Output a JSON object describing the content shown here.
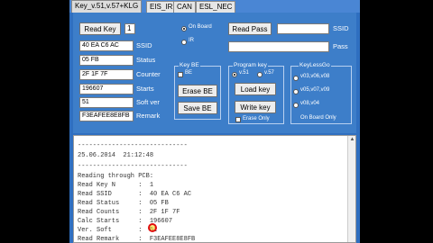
{
  "tabs": [
    {
      "label": "Key_v.51,v.57+KLG"
    },
    {
      "label": "EIS_IR"
    },
    {
      "label": "CAN"
    },
    {
      "label": "ESL_NEC"
    }
  ],
  "read_key": {
    "button": "Read Key",
    "number": "1"
  },
  "onboard": {
    "on_board": "On Board",
    "ir": "IR"
  },
  "read_pass": {
    "button": "Read Pass",
    "ssid_label": "SSID",
    "pass_label": "Pass",
    "ssid_value": "",
    "pass_value": ""
  },
  "fields": [
    {
      "value": "40 EA C6 AC",
      "label": "SSID"
    },
    {
      "value": "05 FB",
      "label": "Status"
    },
    {
      "value": "2F 1F 7F",
      "label": "Counter"
    },
    {
      "value": "196607",
      "label": "Starts"
    },
    {
      "value": "51",
      "label": "Soft ver"
    },
    {
      "value": "F3EAFEE8E8FB",
      "label": "Remark"
    }
  ],
  "key_be": {
    "title": "Key BE",
    "option": "BE",
    "erase": "Erase BE",
    "save": "Save BE"
  },
  "program_key": {
    "title": "Program key",
    "v51": "v.51",
    "v57": "v.57",
    "load": "Load key",
    "write": "Write key",
    "erase_only": "Erase Only"
  },
  "keyless": {
    "title": "KeyLessGo",
    "opt1": "v03,v06,v08",
    "opt2": "v05,v07,v09",
    "opt3": "v08,v04",
    "onboard_only": "On Board Only"
  },
  "log": [
    "-----------------------------",
    "25.06.2014  21:12:48",
    "-----------------------------",
    "Reading through PCB:",
    "Read Key N      :  1",
    "Read SSID       :  40 EA C6 AC",
    "Read Status     :  05 FB",
    "Read Counts     :  2F 1F 7F",
    "Calc Starts     :  196607",
    "Ver. Soft       :  51",
    "Read Remark     :  F3EAFEE8E8FB"
  ]
}
